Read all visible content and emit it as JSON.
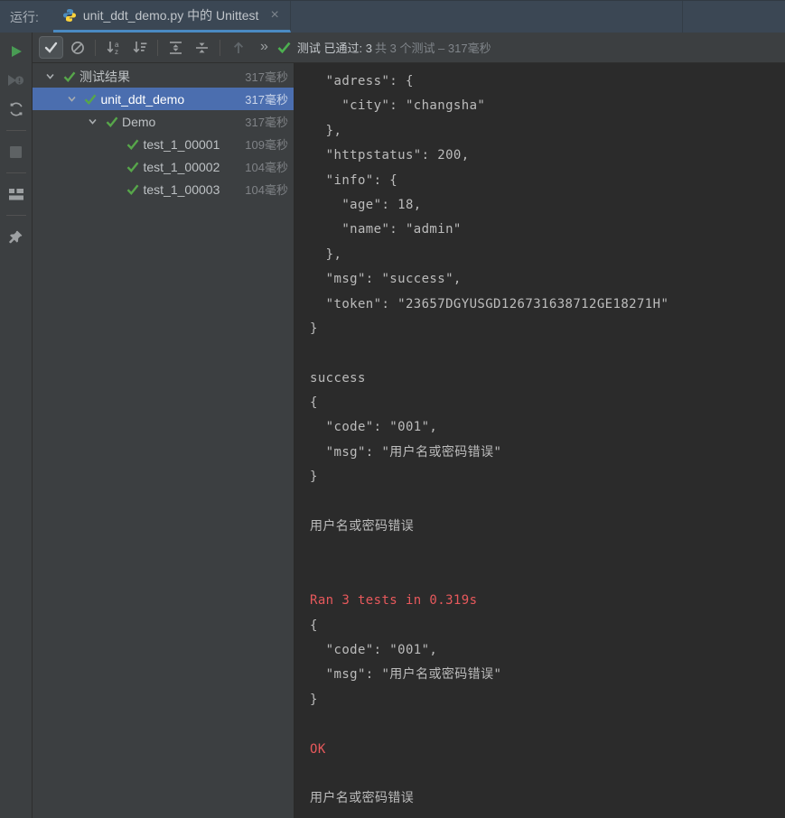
{
  "header": {
    "run_label": "运行:",
    "tab_title": "unit_ddt_demo.py 中的 Unittest",
    "tab_close": "×"
  },
  "toolbar": {
    "overflow": "»",
    "status_passed": "测试 已通过: 3",
    "status_total": "共 3 个测试 – 317毫秒",
    "icons": [
      "show-passed-icon",
      "show-ignored-icon",
      "sort-alphabetically-icon",
      "sort-by-duration-icon",
      "expand-all-icon",
      "collapse-all-icon",
      "previous-failed-test-icon",
      "overflow-chevron-icon",
      "passed-check-icon"
    ]
  },
  "left_rail": {
    "icons": [
      "rerun-icon",
      "rerun-failed-icon",
      "auto-test-icon",
      "stop-icon",
      "restore-layout-icon",
      "pin-icon"
    ]
  },
  "colors": {
    "selection_blue": "#4B6EAF",
    "tab_underline_blue": "#4A8AC2",
    "pass_green": "#57A64A",
    "run_green": "#499C54",
    "error_red": "#E8595C",
    "panel_gray": "#3C3F41",
    "console_bg": "#2B2B2B",
    "header_bg": "#3B4754"
  },
  "tree": {
    "rows": [
      {
        "label": "测试结果",
        "time": "317毫秒",
        "level": 0,
        "expandable": true,
        "selected": false
      },
      {
        "label": "unit_ddt_demo",
        "time": "317毫秒",
        "level": 1,
        "expandable": true,
        "selected": true
      },
      {
        "label": "Demo",
        "time": "317毫秒",
        "level": 2,
        "expandable": true,
        "selected": false
      },
      {
        "label": "test_1_00001",
        "time": "109毫秒",
        "level": 3,
        "expandable": false,
        "selected": false
      },
      {
        "label": "test_1_00002",
        "time": "104毫秒",
        "level": 3,
        "expandable": false,
        "selected": false
      },
      {
        "label": "test_1_00003",
        "time": "104毫秒",
        "level": 3,
        "expandable": false,
        "selected": false
      }
    ]
  },
  "console": {
    "lines": [
      {
        "text": "  \"adress\": {",
        "type": "out"
      },
      {
        "text": "    \"city\": \"changsha\"",
        "type": "out"
      },
      {
        "text": "  },",
        "type": "out"
      },
      {
        "text": "  \"httpstatus\": 200,",
        "type": "out"
      },
      {
        "text": "  \"info\": {",
        "type": "out"
      },
      {
        "text": "    \"age\": 18,",
        "type": "out"
      },
      {
        "text": "    \"name\": \"admin\"",
        "type": "out"
      },
      {
        "text": "  },",
        "type": "out"
      },
      {
        "text": "  \"msg\": \"success\",",
        "type": "out"
      },
      {
        "text": "  \"token\": \"23657DGYUSGD126731638712GE18271H\"",
        "type": "out"
      },
      {
        "text": "}",
        "type": "out"
      },
      {
        "text": "",
        "type": "out"
      },
      {
        "text": "success",
        "type": "out"
      },
      {
        "text": "{",
        "type": "out"
      },
      {
        "text": "  \"code\": \"001\",",
        "type": "out"
      },
      {
        "text": "  \"msg\": \"用户名或密码错误\"",
        "type": "out"
      },
      {
        "text": "}",
        "type": "out"
      },
      {
        "text": "",
        "type": "out"
      },
      {
        "text": "用户名或密码错误",
        "type": "out"
      },
      {
        "text": "",
        "type": "out"
      },
      {
        "text": "",
        "type": "out"
      },
      {
        "text": "Ran 3 tests in 0.319s",
        "type": "err"
      },
      {
        "text": "{",
        "type": "out"
      },
      {
        "text": "  \"code\": \"001\",",
        "type": "out"
      },
      {
        "text": "  \"msg\": \"用户名或密码错误\"",
        "type": "out"
      },
      {
        "text": "}",
        "type": "out"
      },
      {
        "text": "",
        "type": "out"
      },
      {
        "text": "OK",
        "type": "err"
      },
      {
        "text": "",
        "type": "out"
      },
      {
        "text": "用户名或密码错误",
        "type": "out"
      }
    ]
  }
}
